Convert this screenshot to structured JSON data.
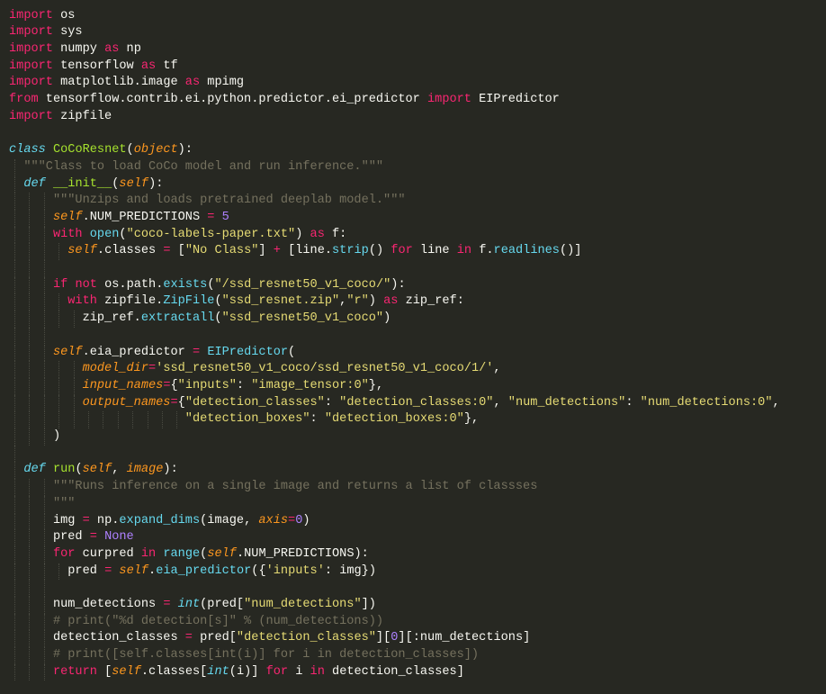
{
  "editor": {
    "theme_colors": {
      "background": "#272822",
      "default": "#f8f8f2",
      "keyword": "#f92672",
      "string": "#e6db74",
      "number": "#ae81ff",
      "comment": "#75715e",
      "function": "#a6e22e",
      "builtin": "#66d9ef",
      "param": "#fd971f"
    },
    "lines": [
      {
        "tokens": [
          {
            "c": "kw",
            "t": "import"
          },
          {
            "c": "tx",
            "t": " os"
          }
        ]
      },
      {
        "tokens": [
          {
            "c": "kw",
            "t": "import"
          },
          {
            "c": "tx",
            "t": " sys"
          }
        ]
      },
      {
        "tokens": [
          {
            "c": "kw",
            "t": "import"
          },
          {
            "c": "tx",
            "t": " numpy "
          },
          {
            "c": "kw",
            "t": "as"
          },
          {
            "c": "tx",
            "t": " np"
          }
        ]
      },
      {
        "tokens": [
          {
            "c": "kw",
            "t": "import"
          },
          {
            "c": "tx",
            "t": " tensorflow "
          },
          {
            "c": "kw",
            "t": "as"
          },
          {
            "c": "tx",
            "t": " tf"
          }
        ]
      },
      {
        "tokens": [
          {
            "c": "kw",
            "t": "import"
          },
          {
            "c": "tx",
            "t": " matplotlib.image "
          },
          {
            "c": "kw",
            "t": "as"
          },
          {
            "c": "tx",
            "t": " mpimg"
          }
        ]
      },
      {
        "tokens": [
          {
            "c": "kw",
            "t": "from"
          },
          {
            "c": "tx",
            "t": " tensorflow.contrib.ei.python.predictor.ei_predictor "
          },
          {
            "c": "kw",
            "t": "import"
          },
          {
            "c": "tx",
            "t": " EIPredictor"
          }
        ]
      },
      {
        "tokens": [
          {
            "c": "kw",
            "t": "import"
          },
          {
            "c": "tx",
            "t": " zipfile"
          }
        ]
      },
      {
        "tokens": []
      },
      {
        "tokens": [
          {
            "c": "ct",
            "t": "class"
          },
          {
            "c": "tx",
            "t": " "
          },
          {
            "c": "fn",
            "t": "CoCoResnet"
          },
          {
            "c": "tx",
            "t": "("
          },
          {
            "c": "ar",
            "t": "object"
          },
          {
            "c": "tx",
            "t": "):"
          }
        ]
      },
      {
        "tokens": [
          {
            "c": "tx",
            "t": "  "
          },
          {
            "c": "cm",
            "t": "\"\"\"Class to load CoCo model and run inference.\"\"\""
          }
        ]
      },
      {
        "tokens": [
          {
            "c": "tx",
            "t": "  "
          },
          {
            "c": "df",
            "t": "def"
          },
          {
            "c": "tx",
            "t": " "
          },
          {
            "c": "fn",
            "t": "__init__"
          },
          {
            "c": "tx",
            "t": "("
          },
          {
            "c": "sf",
            "t": "self"
          },
          {
            "c": "tx",
            "t": "):"
          }
        ]
      },
      {
        "tokens": [
          {
            "c": "tx",
            "t": "      "
          },
          {
            "c": "cm",
            "t": "\"\"\"Unzips and loads pretrained deeplab model.\"\"\""
          }
        ]
      },
      {
        "tokens": [
          {
            "c": "tx",
            "t": "      "
          },
          {
            "c": "sf",
            "t": "self"
          },
          {
            "c": "tx",
            "t": ".NUM_PREDICTIONS "
          },
          {
            "c": "kw",
            "t": "="
          },
          {
            "c": "tx",
            "t": " "
          },
          {
            "c": "nm",
            "t": "5"
          }
        ]
      },
      {
        "tokens": [
          {
            "c": "tx",
            "t": "      "
          },
          {
            "c": "kw",
            "t": "with"
          },
          {
            "c": "tx",
            "t": " "
          },
          {
            "c": "bi",
            "t": "open"
          },
          {
            "c": "tx",
            "t": "("
          },
          {
            "c": "st",
            "t": "\"coco-labels-paper.txt\""
          },
          {
            "c": "tx",
            "t": ") "
          },
          {
            "c": "kw",
            "t": "as"
          },
          {
            "c": "tx",
            "t": " f:"
          }
        ]
      },
      {
        "tokens": [
          {
            "c": "tx",
            "t": "        "
          },
          {
            "c": "sf",
            "t": "self"
          },
          {
            "c": "tx",
            "t": ".classes "
          },
          {
            "c": "kw",
            "t": "="
          },
          {
            "c": "tx",
            "t": " ["
          },
          {
            "c": "st",
            "t": "\"No Class\""
          },
          {
            "c": "tx",
            "t": "] "
          },
          {
            "c": "kw",
            "t": "+"
          },
          {
            "c": "tx",
            "t": " [line."
          },
          {
            "c": "bi",
            "t": "strip"
          },
          {
            "c": "tx",
            "t": "() "
          },
          {
            "c": "kw",
            "t": "for"
          },
          {
            "c": "tx",
            "t": " line "
          },
          {
            "c": "kw",
            "t": "in"
          },
          {
            "c": "tx",
            "t": " f."
          },
          {
            "c": "bi",
            "t": "readlines"
          },
          {
            "c": "tx",
            "t": "()]"
          }
        ]
      },
      {
        "tokens": []
      },
      {
        "tokens": [
          {
            "c": "tx",
            "t": "      "
          },
          {
            "c": "kw",
            "t": "if"
          },
          {
            "c": "tx",
            "t": " "
          },
          {
            "c": "kw",
            "t": "not"
          },
          {
            "c": "tx",
            "t": " os.path."
          },
          {
            "c": "bi",
            "t": "exists"
          },
          {
            "c": "tx",
            "t": "("
          },
          {
            "c": "st",
            "t": "\"/ssd_resnet50_v1_coco/\""
          },
          {
            "c": "tx",
            "t": "):"
          }
        ]
      },
      {
        "tokens": [
          {
            "c": "tx",
            "t": "        "
          },
          {
            "c": "kw",
            "t": "with"
          },
          {
            "c": "tx",
            "t": " zipfile."
          },
          {
            "c": "bi",
            "t": "ZipFile"
          },
          {
            "c": "tx",
            "t": "("
          },
          {
            "c": "st",
            "t": "\"ssd_resnet.zip\""
          },
          {
            "c": "tx",
            "t": ","
          },
          {
            "c": "st",
            "t": "\"r\""
          },
          {
            "c": "tx",
            "t": ") "
          },
          {
            "c": "kw",
            "t": "as"
          },
          {
            "c": "tx",
            "t": " zip_ref:"
          }
        ]
      },
      {
        "tokens": [
          {
            "c": "tx",
            "t": "          zip_ref."
          },
          {
            "c": "bi",
            "t": "extractall"
          },
          {
            "c": "tx",
            "t": "("
          },
          {
            "c": "st",
            "t": "\"ssd_resnet50_v1_coco\""
          },
          {
            "c": "tx",
            "t": ")"
          }
        ]
      },
      {
        "tokens": []
      },
      {
        "tokens": [
          {
            "c": "tx",
            "t": "      "
          },
          {
            "c": "sf",
            "t": "self"
          },
          {
            "c": "tx",
            "t": ".eia_predictor "
          },
          {
            "c": "kw",
            "t": "="
          },
          {
            "c": "tx",
            "t": " "
          },
          {
            "c": "bi",
            "t": "EIPredictor"
          },
          {
            "c": "tx",
            "t": "("
          }
        ]
      },
      {
        "tokens": [
          {
            "c": "tx",
            "t": "          "
          },
          {
            "c": "ar",
            "t": "model_dir"
          },
          {
            "c": "kw",
            "t": "="
          },
          {
            "c": "st",
            "t": "'ssd_resnet50_v1_coco/ssd_resnet50_v1_coco/1/'"
          },
          {
            "c": "tx",
            "t": ","
          }
        ]
      },
      {
        "tokens": [
          {
            "c": "tx",
            "t": "          "
          },
          {
            "c": "ar",
            "t": "input_names"
          },
          {
            "c": "kw",
            "t": "="
          },
          {
            "c": "tx",
            "t": "{"
          },
          {
            "c": "st",
            "t": "\"inputs\""
          },
          {
            "c": "tx",
            "t": ": "
          },
          {
            "c": "st",
            "t": "\"image_tensor:0\""
          },
          {
            "c": "tx",
            "t": "},"
          }
        ]
      },
      {
        "tokens": [
          {
            "c": "tx",
            "t": "          "
          },
          {
            "c": "ar",
            "t": "output_names"
          },
          {
            "c": "kw",
            "t": "="
          },
          {
            "c": "tx",
            "t": "{"
          },
          {
            "c": "st",
            "t": "\"detection_classes\""
          },
          {
            "c": "tx",
            "t": ": "
          },
          {
            "c": "st",
            "t": "\"detection_classes:0\""
          },
          {
            "c": "tx",
            "t": ", "
          },
          {
            "c": "st",
            "t": "\"num_detections\""
          },
          {
            "c": "tx",
            "t": ": "
          },
          {
            "c": "st",
            "t": "\"num_detections:0\""
          },
          {
            "c": "tx",
            "t": ","
          }
        ]
      },
      {
        "tokens": [
          {
            "c": "tx",
            "t": "                        "
          },
          {
            "c": "st",
            "t": "\"detection_boxes\""
          },
          {
            "c": "tx",
            "t": ": "
          },
          {
            "c": "st",
            "t": "\"detection_boxes:0\""
          },
          {
            "c": "tx",
            "t": "},"
          }
        ]
      },
      {
        "tokens": [
          {
            "c": "tx",
            "t": "      )"
          }
        ]
      },
      {
        "tokens": []
      },
      {
        "tokens": [
          {
            "c": "tx",
            "t": "  "
          },
          {
            "c": "df",
            "t": "def"
          },
          {
            "c": "tx",
            "t": " "
          },
          {
            "c": "fn",
            "t": "run"
          },
          {
            "c": "tx",
            "t": "("
          },
          {
            "c": "sf",
            "t": "self"
          },
          {
            "c": "tx",
            "t": ", "
          },
          {
            "c": "ar",
            "t": "image"
          },
          {
            "c": "tx",
            "t": "):"
          }
        ]
      },
      {
        "tokens": [
          {
            "c": "tx",
            "t": "      "
          },
          {
            "c": "cm",
            "t": "\"\"\"Runs inference on a single image and returns a list of classses"
          }
        ]
      },
      {
        "tokens": [
          {
            "c": "tx",
            "t": "      "
          },
          {
            "c": "cm",
            "t": "\"\"\""
          }
        ]
      },
      {
        "tokens": [
          {
            "c": "tx",
            "t": "      img "
          },
          {
            "c": "kw",
            "t": "="
          },
          {
            "c": "tx",
            "t": " np."
          },
          {
            "c": "bi",
            "t": "expand_dims"
          },
          {
            "c": "tx",
            "t": "(image, "
          },
          {
            "c": "ar",
            "t": "axis"
          },
          {
            "c": "kw",
            "t": "="
          },
          {
            "c": "nm",
            "t": "0"
          },
          {
            "c": "tx",
            "t": ")"
          }
        ]
      },
      {
        "tokens": [
          {
            "c": "tx",
            "t": "      pred "
          },
          {
            "c": "kw",
            "t": "="
          },
          {
            "c": "tx",
            "t": " "
          },
          {
            "c": "nm",
            "t": "None"
          }
        ]
      },
      {
        "tokens": [
          {
            "c": "tx",
            "t": "      "
          },
          {
            "c": "kw",
            "t": "for"
          },
          {
            "c": "tx",
            "t": " curpred "
          },
          {
            "c": "kw",
            "t": "in"
          },
          {
            "c": "tx",
            "t": " "
          },
          {
            "c": "bi",
            "t": "range"
          },
          {
            "c": "tx",
            "t": "("
          },
          {
            "c": "sf",
            "t": "self"
          },
          {
            "c": "tx",
            "t": ".NUM_PREDICTIONS):"
          }
        ]
      },
      {
        "tokens": [
          {
            "c": "tx",
            "t": "        pred "
          },
          {
            "c": "kw",
            "t": "="
          },
          {
            "c": "tx",
            "t": " "
          },
          {
            "c": "sf",
            "t": "self"
          },
          {
            "c": "tx",
            "t": "."
          },
          {
            "c": "bi",
            "t": "eia_predictor"
          },
          {
            "c": "tx",
            "t": "({"
          },
          {
            "c": "st",
            "t": "'inputs'"
          },
          {
            "c": "tx",
            "t": ": img})"
          }
        ]
      },
      {
        "tokens": []
      },
      {
        "tokens": [
          {
            "c": "tx",
            "t": "      num_detections "
          },
          {
            "c": "kw",
            "t": "="
          },
          {
            "c": "tx",
            "t": " "
          },
          {
            "c": "ct",
            "t": "int"
          },
          {
            "c": "tx",
            "t": "(pred["
          },
          {
            "c": "st",
            "t": "\"num_detections\""
          },
          {
            "c": "tx",
            "t": "])"
          }
        ]
      },
      {
        "tokens": [
          {
            "c": "tx",
            "t": "      "
          },
          {
            "c": "cm",
            "t": "# print(\"%d detection[s]\" % (num_detections))"
          }
        ]
      },
      {
        "tokens": [
          {
            "c": "tx",
            "t": "      detection_classes "
          },
          {
            "c": "kw",
            "t": "="
          },
          {
            "c": "tx",
            "t": " pred["
          },
          {
            "c": "st",
            "t": "\"detection_classes\""
          },
          {
            "c": "tx",
            "t": "]["
          },
          {
            "c": "nm",
            "t": "0"
          },
          {
            "c": "tx",
            "t": "][:num_detections]"
          }
        ]
      },
      {
        "tokens": [
          {
            "c": "tx",
            "t": "      "
          },
          {
            "c": "cm",
            "t": "# print([self.classes[int(i)] for i in detection_classes])"
          }
        ]
      },
      {
        "tokens": [
          {
            "c": "tx",
            "t": "      "
          },
          {
            "c": "kw",
            "t": "return"
          },
          {
            "c": "tx",
            "t": " ["
          },
          {
            "c": "sf",
            "t": "self"
          },
          {
            "c": "tx",
            "t": ".classes["
          },
          {
            "c": "ct",
            "t": "int"
          },
          {
            "c": "tx",
            "t": "(i)] "
          },
          {
            "c": "kw",
            "t": "for"
          },
          {
            "c": "tx",
            "t": " i "
          },
          {
            "c": "kw",
            "t": "in"
          },
          {
            "c": "tx",
            "t": " detection_classes]"
          }
        ]
      }
    ]
  }
}
